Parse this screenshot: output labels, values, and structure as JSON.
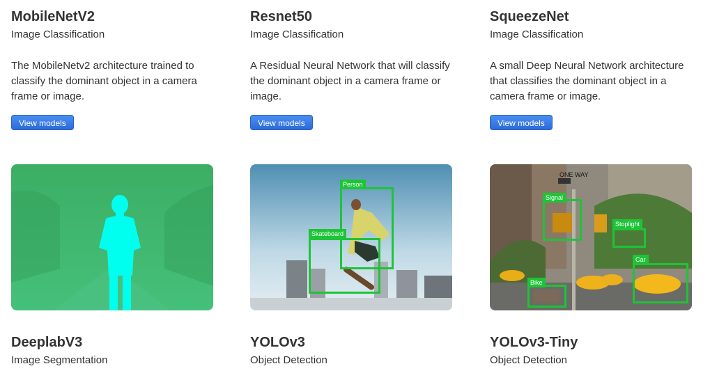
{
  "models_top": [
    {
      "name": "MobileNetV2",
      "category": "Image Classification",
      "description": "The MobileNetv2 architecture trained to classify the dominant object in a camera frame or image.",
      "button": "View models"
    },
    {
      "name": "Resnet50",
      "category": "Image Classification",
      "description": "A Residual Neural Network that will classify the dominant object in a camera frame or image.",
      "button": "View models"
    },
    {
      "name": "SqueezeNet",
      "category": "Image Classification",
      "description": "A small Deep Neural Network architecture that classifies the dominant object in a camera frame or image.",
      "button": "View models"
    }
  ],
  "models_bottom": [
    {
      "name": "DeeplabV3",
      "category": "Image Segmentation"
    },
    {
      "name": "YOLOv3",
      "category": "Object Detection",
      "labels": [
        "Person",
        "Skateboard"
      ]
    },
    {
      "name": "YOLOv3-Tiny",
      "category": "Object Detection",
      "labels": [
        "Signal",
        "Stoplight",
        "Car",
        "Bike"
      ],
      "street_sign": "ONE WAY"
    }
  ],
  "colors": {
    "button": "#3279e0",
    "detection": "#1ec437",
    "segmentation_bg": "#3cb870",
    "segmentation_mask": "#00ffee"
  }
}
